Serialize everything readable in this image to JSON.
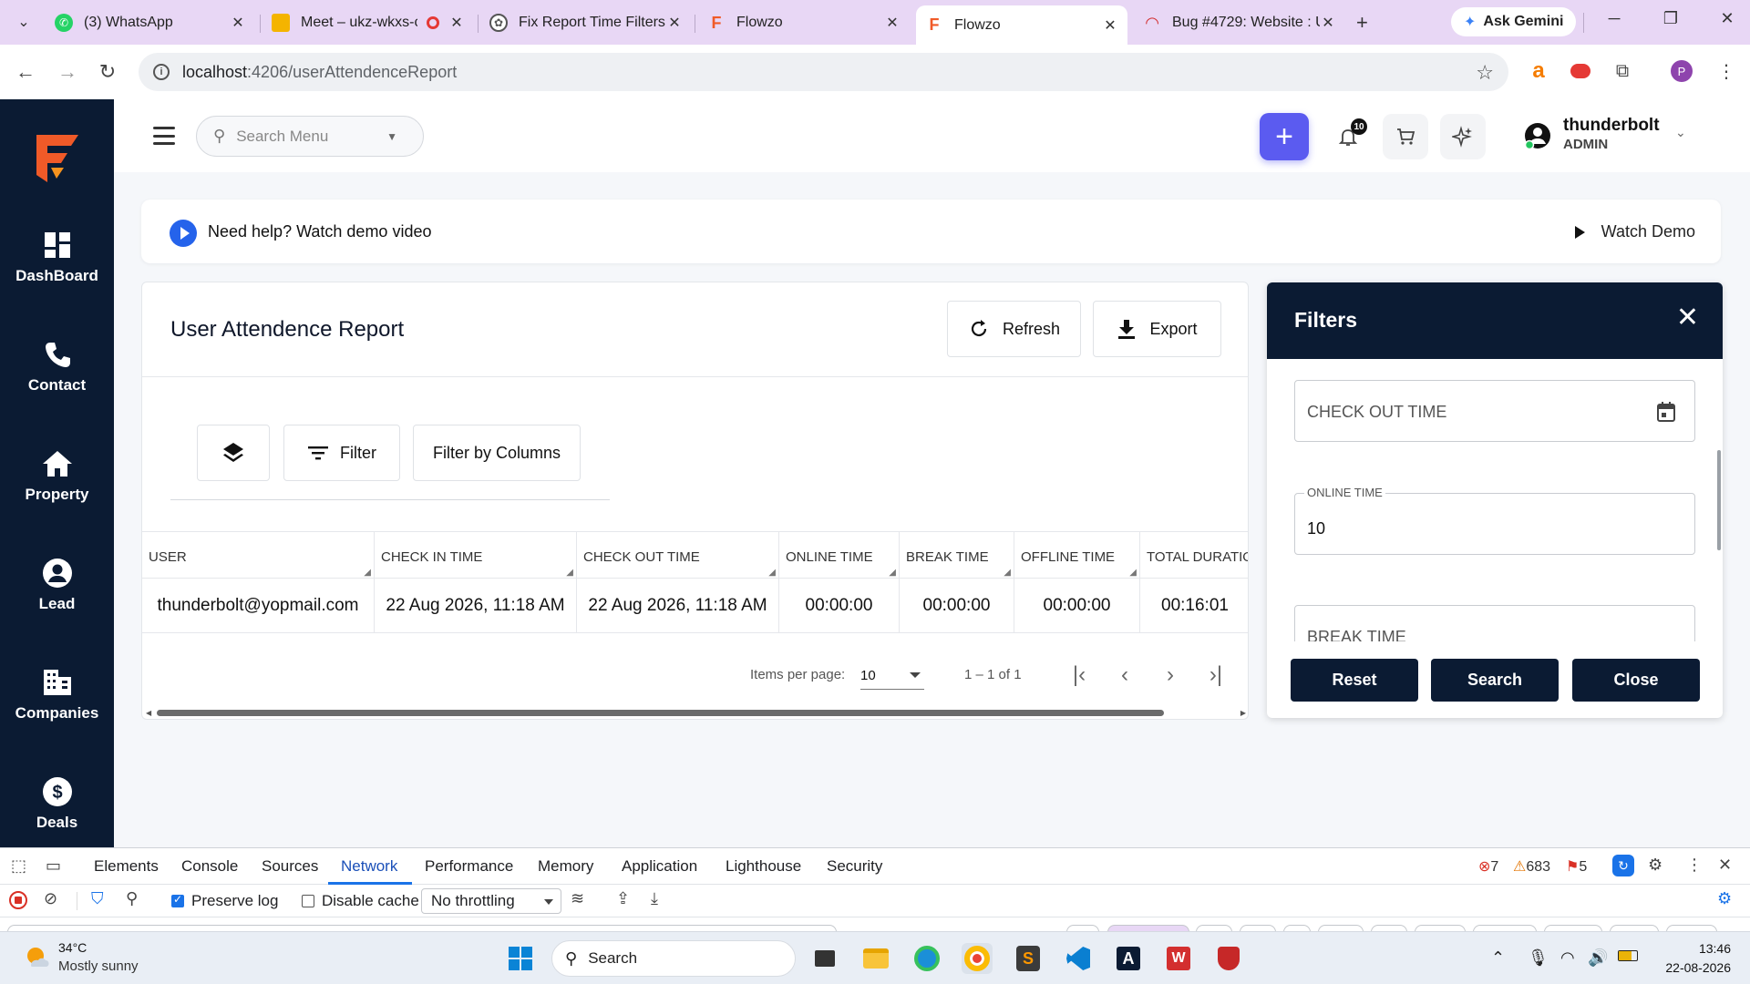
{
  "browser": {
    "tabs": [
      {
        "title": "(3) WhatsApp",
        "favicon": "whatsapp-icon",
        "color": "#25d366"
      },
      {
        "title": "Meet – ukz-wkxs-c",
        "favicon": "meet-icon",
        "color": "#f4b400"
      },
      {
        "title": "Fix Report Time Filters",
        "favicon": "chatgpt-icon",
        "color": "#555555"
      },
      {
        "title": "Flowzo",
        "favicon": "flowzo-icon",
        "color": "#f05a28"
      },
      {
        "title": "Flowzo",
        "favicon": "flowzo-icon",
        "color": "#f05a28"
      },
      {
        "title": "Bug #4729: Website : U",
        "favicon": "redmine-icon",
        "color": "#d32f2f"
      }
    ],
    "gemini_label": "Ask Gemini",
    "url_host": "localhost",
    "url_path": ":4206/userAttendenceReport",
    "profile_initial": "P"
  },
  "sidebar": {
    "items": [
      {
        "label": "DashBoard",
        "icon": "dashboard-icon"
      },
      {
        "label": "Contact",
        "icon": "phone-icon"
      },
      {
        "label": "Property",
        "icon": "home-icon"
      },
      {
        "label": "Lead",
        "icon": "user-circle-icon"
      },
      {
        "label": "Companies",
        "icon": "building-icon"
      },
      {
        "label": "Deals",
        "icon": "dollar-icon"
      }
    ]
  },
  "header": {
    "search_placeholder": "Search Menu",
    "notification_count": "10",
    "user_name": "thunderbolt",
    "user_role": "ADMIN"
  },
  "banner": {
    "help_text": "Need help? Watch demo video",
    "watch_demo": "Watch Demo"
  },
  "report": {
    "title": "User Attendence Report",
    "refresh_label": "Refresh",
    "export_label": "Export",
    "filter_label": "Filter",
    "filter_columns_label": "Filter by Columns",
    "columns": [
      "USER",
      "CHECK IN TIME",
      "CHECK OUT TIME",
      "ONLINE TIME",
      "BREAK TIME",
      "OFFLINE TIME",
      "TOTAL DURATIO"
    ],
    "rows": [
      [
        "thunderbolt@yopmail.com",
        "22 Aug 2026, 11:18 AM",
        "22 Aug 2026, 11:18 AM",
        "00:00:00",
        "00:00:00",
        "00:00:00",
        "00:16:01"
      ]
    ],
    "paginator": {
      "items_per_page_label": "Items per page:",
      "page_size": "10",
      "range_label": "1 – 1 of 1"
    }
  },
  "filters": {
    "title": "Filters",
    "check_out_time_label": "CHECK OUT TIME",
    "online_time_label": "ONLINE TIME",
    "online_time_value": "10",
    "break_time_label": "BREAK TIME",
    "reset_label": "Reset",
    "search_label": "Search",
    "close_label": "Close"
  },
  "devtools": {
    "tabs": [
      "Elements",
      "Console",
      "Sources",
      "Network",
      "Performance",
      "Memory",
      "Application",
      "Lighthouse",
      "Security"
    ],
    "active_tab": "Network",
    "errors": "7",
    "warnings": "683",
    "issues": "5",
    "preserve_log": "Preserve log",
    "disable_cache": "Disable cache",
    "throttling": "No throttling"
  },
  "taskbar": {
    "temperature": "34°C",
    "weather": "Mostly sunny",
    "search_label": "Search",
    "time": "13:46",
    "date": "22-08-2026"
  },
  "colors": {
    "sidebar_bg": "#0b1b33",
    "accent": "#5b5bf0",
    "brand_orange": "#f05a28"
  }
}
